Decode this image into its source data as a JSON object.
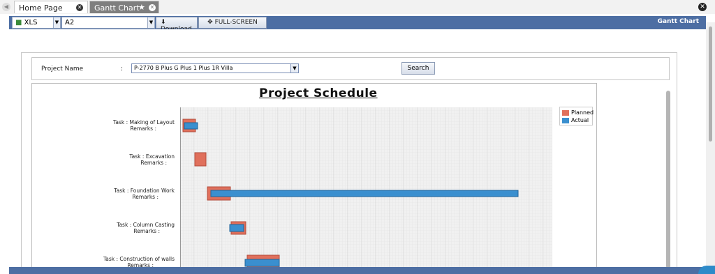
{
  "tabs": [
    {
      "label": "Home Page",
      "active": false
    },
    {
      "label": "Gantt Chart",
      "active": true
    }
  ],
  "toolbar": {
    "format_value": "XLS",
    "paper_value": "A2",
    "download_label": "Download",
    "fullscreen_label": "FULL-SCREEN",
    "title": "Gantt Chart"
  },
  "filter": {
    "project_label": "Project Name",
    "colon": ":",
    "project_value": "P-2770 B Plus G Plus 1 Plus 1R Villa",
    "search_label": "Search"
  },
  "chart_data": {
    "type": "gantt",
    "title": "Project Schedule",
    "legend": [
      {
        "name": "Planned",
        "color": "#e0705c"
      },
      {
        "name": "Actual",
        "color": "#3a8fcf"
      }
    ],
    "tasks": [
      {
        "task": "Task : Making of Layout",
        "remarks": "Remarks :"
      },
      {
        "task": "Task : Excavation",
        "remarks": "Remarks :"
      },
      {
        "task": "Task : Foundation Work",
        "remarks": "Remarks :"
      },
      {
        "task": "Task : Column Casting",
        "remarks": "Remarks :"
      },
      {
        "task": "Task : Construction of walls",
        "remarks": "Remarks :"
      }
    ]
  },
  "colors": {
    "toolbar_bg": "#4d6ea3",
    "planned": "#e0705c",
    "actual": "#3a8fcf"
  }
}
